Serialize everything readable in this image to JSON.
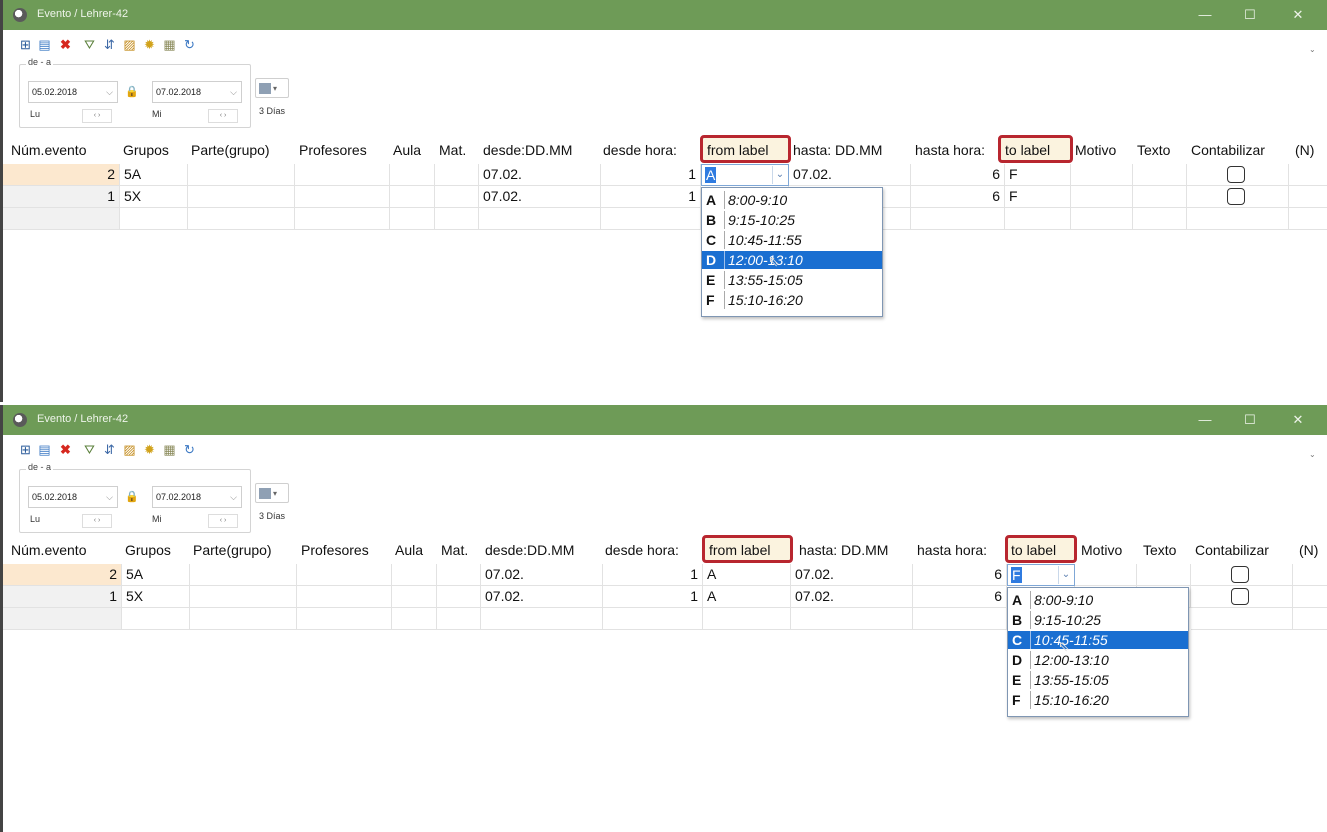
{
  "window": {
    "title": "Evento / Lehrer-42",
    "controls": [
      "—",
      "☐",
      "✕"
    ]
  },
  "toolbar": {
    "icons": [
      "grid-add-icon",
      "details-icon",
      "delete-icon",
      "filter-icon",
      "sort-icon",
      "document-icon",
      "settings-icon",
      "calendar-icon",
      "refresh-icon"
    ]
  },
  "daterange": {
    "legend": "de - a",
    "from_date": "05.02.2018",
    "from_day": "Lu",
    "to_date": "07.02.2018",
    "to_day": "Mi",
    "spinner": "‹ ›",
    "view_label": "3 Días"
  },
  "columns": [
    "Núm.evento",
    "Grupos",
    "Parte(grupo)",
    "Profesores",
    "Aula",
    "Mat.",
    "desde:DD.MM",
    "desde hora:",
    "from label",
    "hasta: DD.MM",
    "hasta hora:",
    "to label",
    "Motivo",
    "Texto",
    "Contabilizar",
    "(N)"
  ],
  "rows": [
    {
      "num": "2",
      "grupos": "5A",
      "desde_date": "07.02.",
      "desde_hora": "1",
      "from_label": "A",
      "hasta_date": "07.02.",
      "hasta_hora": "6",
      "to_label": "F"
    },
    {
      "num": "1",
      "grupos": "5X",
      "desde_date": "07.02.",
      "desde_hora": "1",
      "from_label": "A",
      "hasta_date": "07.02.",
      "hasta_hora": "6",
      "to_label": "F"
    }
  ],
  "dropdown_options": [
    {
      "key": "A",
      "time": "8:00-9:10"
    },
    {
      "key": "B",
      "time": "9:15-10:25"
    },
    {
      "key": "C",
      "time": "10:45-11:55"
    },
    {
      "key": "D",
      "time": "12:00-13:10"
    },
    {
      "key": "E",
      "time": "13:55-15:05"
    },
    {
      "key": "F",
      "time": "15:10-16:20"
    }
  ],
  "panel1_selected_option": "D",
  "panel2_selected_option": "C",
  "highlight_color": "#b8262f",
  "selection_color": "#1a73d1",
  "titlebar_color": "#6e9b57"
}
